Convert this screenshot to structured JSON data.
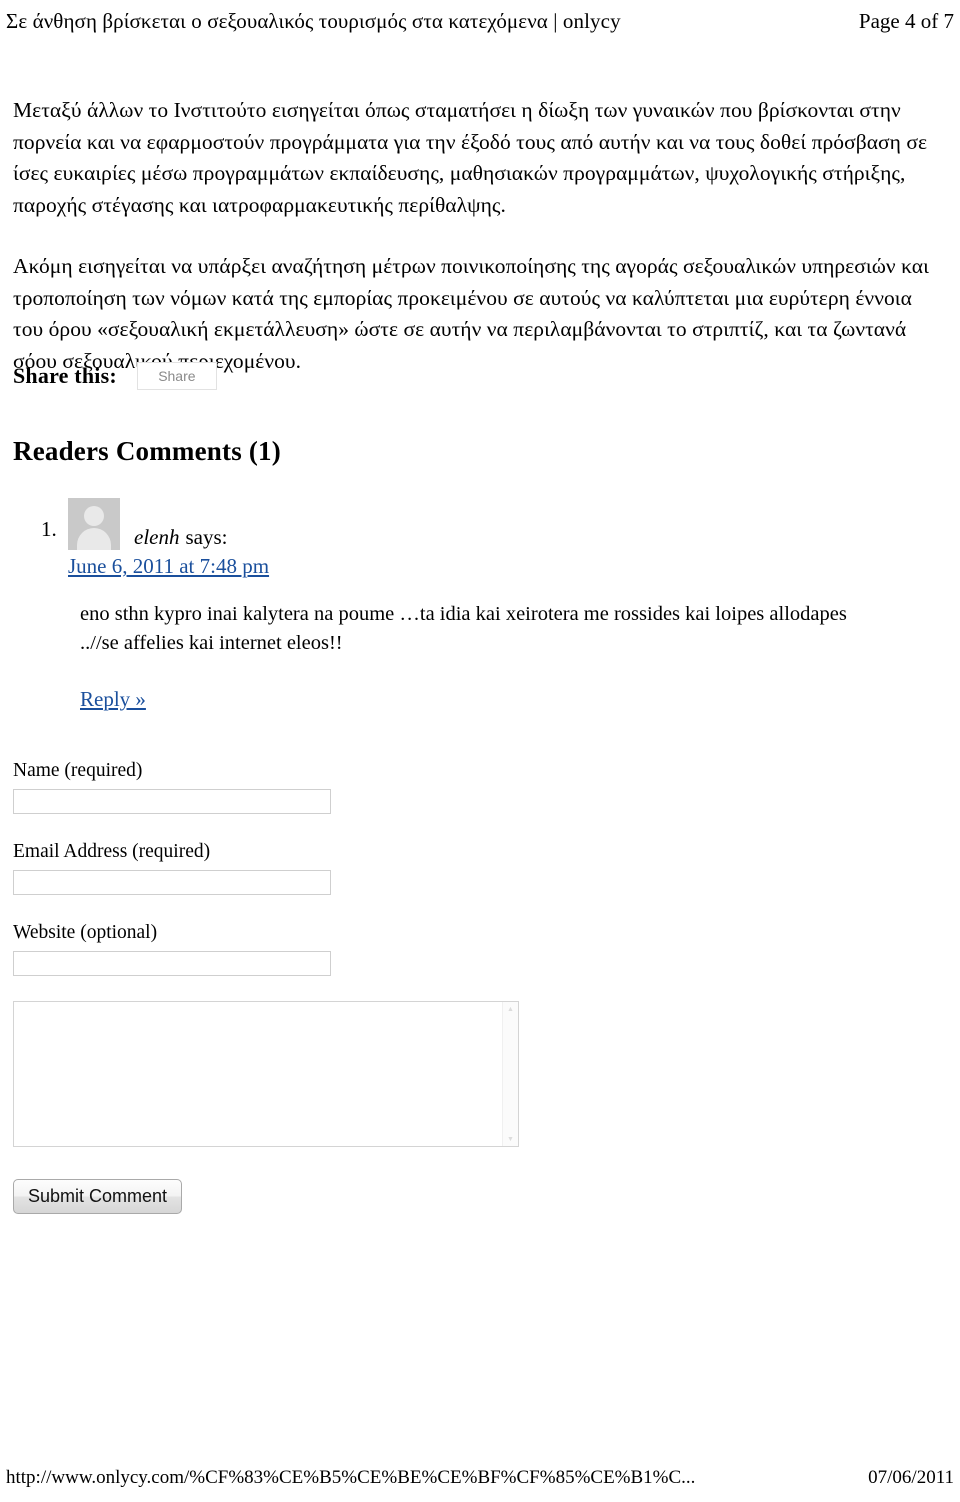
{
  "header": {
    "title": "Σε άνθηση βρίσκεται ο σεξουαλικός τουρισμός στα κατεχόμενα | onlycy",
    "page_indicator": "Page 4 of 7"
  },
  "article": {
    "paragraphs": [
      "Μεταξύ άλλων το Ινστιτούτο εισηγείται όπως σταματήσει η δίωξη των γυναικών που βρίσκονται στην πορνεία και να εφαρμοστούν προγράμματα για την έξοδό τους από αυτήν και να τους δοθεί πρόσβαση σε ίσες ευκαιρίες μέσω προγραμμάτων εκπαίδευσης, μαθησιακών προγραμμάτων, ψυχολογικής στήριξης, παροχής στέγασης και ιατροφαρμακευτικής περίθαλψης.",
      "Ακόμη εισηγείται να υπάρξει αναζήτηση μέτρων ποινικοποίησης της αγοράς σεξουαλικών υπηρεσιών και τροποποίηση των νόμων κατά της εμπορίας προκειμένου σε αυτούς να καλύπτεται μια ευρύτερη έννοια του όρου «σεξουαλική εκμετάλλευση» ώστε σε αυτήν να περιλαμβάνονται το στριπτίζ, και τα ζωντανά σόου σεξουαλικού περιεχομένου."
    ]
  },
  "share": {
    "label": "Share this:",
    "button_label": "Share"
  },
  "comments": {
    "heading": "Readers Comments (1)",
    "items": [
      {
        "marker": "1.",
        "author": "elenh",
        "says": "says:",
        "date": "June 6, 2011 at 7:48 pm",
        "body": "eno sthn kypro inai kalytera na poume …ta idia kai xeirotera me rossides kai loipes allodapes ..//se affelies kai internet eleos!!",
        "reply_label": "Reply »"
      }
    ]
  },
  "form": {
    "name_label": "Name (required)",
    "name_value": "",
    "name_placeholder": "",
    "email_label": "Email Address (required)",
    "email_value": "",
    "email_placeholder": "",
    "website_label": "Website (optional)",
    "website_value": "",
    "website_placeholder": "",
    "comment_value": "",
    "comment_placeholder": "",
    "submit_label": "Submit Comment",
    "scroll_up_glyph": "▲",
    "scroll_down_glyph": "▼"
  },
  "footer": {
    "url": "http://www.onlycy.com/%CF%83%CE%B5%CE%BE%CE%BF%CF%85%CE%B1%C...",
    "date": "07/06/2011"
  },
  "colors": {
    "link": "#1a4f9c",
    "avatar_bg": "#c9c9c9",
    "border": "#cfcfcf"
  }
}
